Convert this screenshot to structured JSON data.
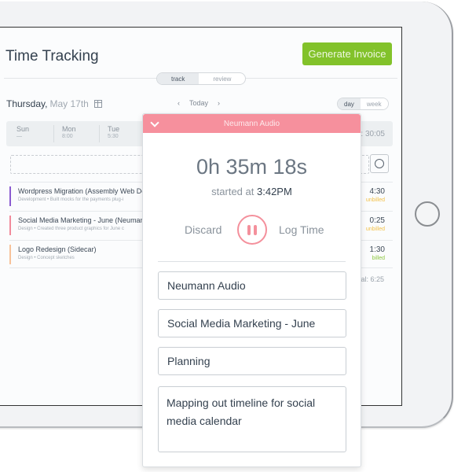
{
  "app": {
    "title": "Time Tracking",
    "generate_invoice_label": "Generate Invoice"
  },
  "mode_toggle": {
    "track": "track",
    "review": "review",
    "active": "track"
  },
  "date": {
    "weekday": "Thursday,",
    "date": "May 17th"
  },
  "nav": {
    "prev": "‹",
    "today": "Today",
    "next": "›"
  },
  "view_toggle": {
    "day": "day",
    "week": "week",
    "active": "day"
  },
  "week": {
    "days": [
      {
        "name": "Sun",
        "hours": "—"
      },
      {
        "name": "Mon",
        "hours": "8:00"
      },
      {
        "name": "Tue",
        "hours": "5:30"
      }
    ],
    "total": ": 30:05"
  },
  "entries": [
    {
      "title": "Wordpress Migration (Assembly Web De",
      "desc": "Development  •  Built mocks for the payments plug-i",
      "duration": "4:30",
      "status": "unbilled",
      "color": "#8a5bd0",
      "status_color": "#f2c14a"
    },
    {
      "title": "Social Media Marketing - June (Neuman",
      "desc": "Design  •  Created three product graphics for June c",
      "duration": "0:25",
      "status": "unbilled",
      "color": "#f18a9b",
      "status_color": "#f2c14a"
    },
    {
      "title": "Logo Redesign (Sidecar)",
      "desc": "Design  •  Concept sketches",
      "duration": "1:30",
      "status": "billed",
      "color": "#f7c29a",
      "status_color": "#8cc63f"
    }
  ],
  "day_total": "al: 6:25",
  "timer": {
    "client_header": "Neumann Audio",
    "elapsed": "0h 35m 18s",
    "started_prefix": "started at",
    "started_time": "3:42PM",
    "discard_label": "Discard",
    "log_label": "Log Time",
    "client": "Neumann Audio",
    "project": "Social Media Marketing - June",
    "task": "Planning",
    "notes": "Mapping out timeline for social media calendar"
  },
  "colors": {
    "accent_green": "#82c22a",
    "timer_pink": "#f6909d"
  }
}
